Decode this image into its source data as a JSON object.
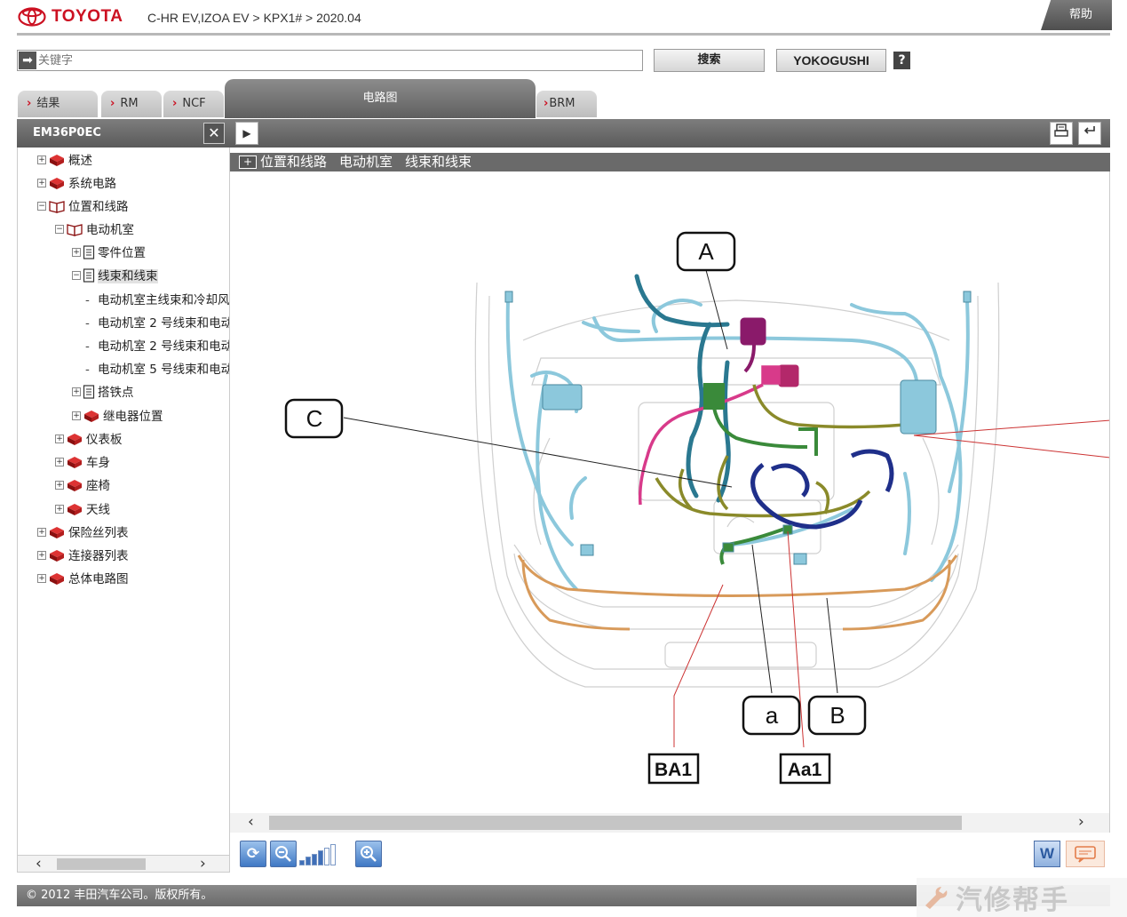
{
  "header": {
    "logo_text": "TOYOTA",
    "breadcrumb": "C-HR EV,IZOA EV > KPX1# > 2020.04",
    "help_label": "帮助",
    "brand_color": "#cc1122"
  },
  "search": {
    "placeholder": "关键字",
    "search_label": "搜索",
    "yokogushi_label": "YOKOGUSHI",
    "help_icon_text": "?"
  },
  "tabs": [
    {
      "label": "结果"
    },
    {
      "label": "RM"
    },
    {
      "label": "NCF"
    },
    {
      "label": "电路图",
      "active": true
    },
    {
      "label": "BRM"
    }
  ],
  "left_panel": {
    "title": "EM36P0EC",
    "close_icon_text": "✕",
    "tree": [
      {
        "label": "概述",
        "toggle": "+",
        "icon": "book-closed-icon"
      },
      {
        "label": "系统电路",
        "toggle": "+",
        "icon": "book-closed-icon"
      },
      {
        "label": "位置和线路",
        "toggle": "−",
        "icon": "book-open-icon"
      },
      {
        "label": "电动机室",
        "toggle": "−",
        "icon": "book-open-icon"
      },
      {
        "label": "零件位置",
        "toggle": "+",
        "icon": "document-icon"
      },
      {
        "label": "线束和线束",
        "toggle": "−",
        "icon": "document-icon",
        "selected": true
      },
      {
        "label": "电动机室主线束和冷却风",
        "toggle": "-",
        "icon": "none"
      },
      {
        "label": "电动机室 2 号线束和电动",
        "toggle": "-",
        "icon": "none"
      },
      {
        "label": "电动机室 2 号线束和电动",
        "toggle": "-",
        "icon": "none"
      },
      {
        "label": "电动机室 5 号线束和电动",
        "toggle": "-",
        "icon": "none"
      },
      {
        "label": "搭铁点",
        "toggle": "+",
        "icon": "document-icon"
      },
      {
        "label": "继电器位置",
        "toggle": "+",
        "icon": "book-closed-icon"
      },
      {
        "label": "仪表板",
        "toggle": "+",
        "icon": "book-closed-icon"
      },
      {
        "label": "车身",
        "toggle": "+",
        "icon": "book-closed-icon"
      },
      {
        "label": "座椅",
        "toggle": "+",
        "icon": "book-closed-icon"
      },
      {
        "label": "天线",
        "toggle": "+",
        "icon": "book-closed-icon"
      },
      {
        "label": "保险丝列表",
        "toggle": "+",
        "icon": "book-closed-icon"
      },
      {
        "label": "连接器列表",
        "toggle": "+",
        "icon": "book-closed-icon"
      },
      {
        "label": "总体电路图",
        "toggle": "+",
        "icon": "book-closed-icon"
      }
    ]
  },
  "diagram": {
    "title_plus": "+",
    "title_segments": [
      "位置和线路",
      "电动机室",
      "线束和线束"
    ],
    "callouts": {
      "A": "A",
      "B": "B",
      "C": "C",
      "a": "a",
      "BA1": "BA1",
      "Aa1": "Aa1"
    },
    "harness_colors": {
      "light_blue": "#8cc8dc",
      "dark_teal": "#2a7890",
      "olive": "#8a8a2a",
      "navy": "#1f2f8a",
      "magenta": "#8a1a6a",
      "pink": "#d83a8a",
      "green": "#3a8a3a",
      "orange": "#d89a5a",
      "leader_red": "#cc3333"
    }
  },
  "zoom": {
    "levels_total": 6,
    "levels_filled": 4
  },
  "footer": {
    "copyright": "© 2012 丰田汽车公司。版权所有。",
    "watermark": "汽修帮手"
  }
}
